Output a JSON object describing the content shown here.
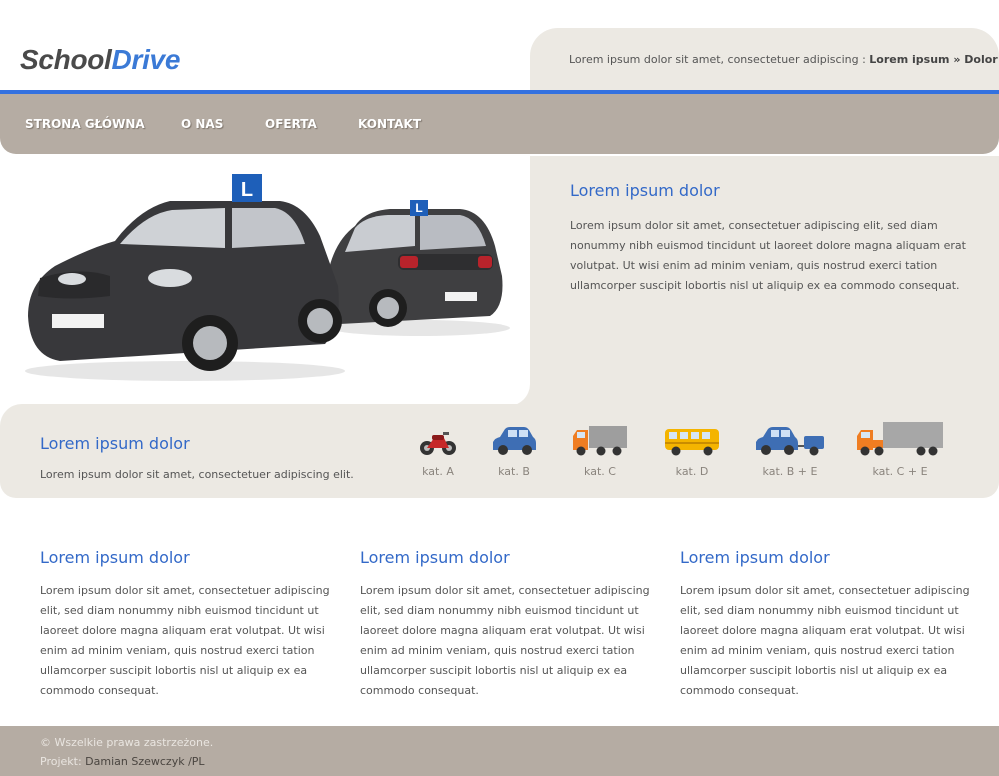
{
  "header": {
    "logo_part1": "School",
    "logo_part2": "Drive",
    "breadcrumb_text": "Lorem ipsum dolor sit amet, consectetuer adipiscing : ",
    "breadcrumb_link1": "Lorem ipsum",
    "breadcrumb_sep": " » ",
    "breadcrumb_link2": "Dolor"
  },
  "nav": {
    "items": [
      {
        "label": "STRONA GŁÓWNA"
      },
      {
        "label": "O NAS"
      },
      {
        "label": "OFERTA"
      },
      {
        "label": "KONTAKT"
      }
    ]
  },
  "hero": {
    "title": "Lorem ipsum dolor",
    "text": "Lorem ipsum dolor sit amet, consectetuer adipiscing elit, sed diam nonummy nibh euismod tincidunt ut laoreet dolore magna aliquam erat volutpat. Ut wisi enim ad minim veniam, quis nostrud exerci tation ullamcorper suscipit lobortis nisl ut aliquip ex ea commodo consequat.",
    "sign_letter": "L"
  },
  "band": {
    "title": "Lorem ipsum dolor",
    "text": "Lorem ipsum dolor sit amet, consectetuer adipiscing elit.",
    "categories": [
      {
        "label": "kat. A",
        "icon": "motorcycle-icon"
      },
      {
        "label": "kat. B",
        "icon": "car-icon"
      },
      {
        "label": "kat. C",
        "icon": "truck-icon"
      },
      {
        "label": "kat. D",
        "icon": "bus-icon"
      },
      {
        "label": "kat. B + E",
        "icon": "car-trailer-icon"
      },
      {
        "label": "kat. C + E",
        "icon": "truck-trailer-icon"
      }
    ]
  },
  "columns": [
    {
      "title": "Lorem ipsum dolor",
      "text": "Lorem ipsum dolor sit amet, consectetuer adipiscing elit, sed diam nonummy nibh euismod tincidunt ut laoreet dolore magna aliquam erat volutpat. Ut wisi enim ad minim veniam, quis nostrud exerci tation ullamcorper suscipit lobortis nisl ut aliquip ex ea commodo consequat."
    },
    {
      "title": "Lorem ipsum dolor",
      "text": "Lorem ipsum dolor sit amet, consectetuer adipiscing elit, sed diam nonummy nibh euismod tincidunt ut laoreet dolore magna aliquam erat volutpat. Ut wisi enim ad minim veniam, quis nostrud exerci tation ullamcorper suscipit lobortis nisl ut aliquip ex ea commodo consequat."
    },
    {
      "title": "Lorem ipsum dolor",
      "text": "Lorem ipsum dolor sit amet, consectetuer adipiscing elit, sed diam nonummy nibh euismod tincidunt ut laoreet dolore magna aliquam erat volutpat. Ut wisi enim ad minim veniam, quis nostrud exerci tation ullamcorper suscipit lobortis nisl ut aliquip ex ea commodo consequat."
    }
  ],
  "footer": {
    "copyright": "© Wszelkie prawa zastrzeżone.",
    "project_label": "Projekt: ",
    "project_name": "Damian Szewczyk",
    "project_suffix": " /PL"
  },
  "colors": {
    "accent_blue": "#3371e0",
    "nav_bg": "#b5aca3",
    "panel_bg": "#ece9e3",
    "heading_blue": "#3369c8"
  }
}
